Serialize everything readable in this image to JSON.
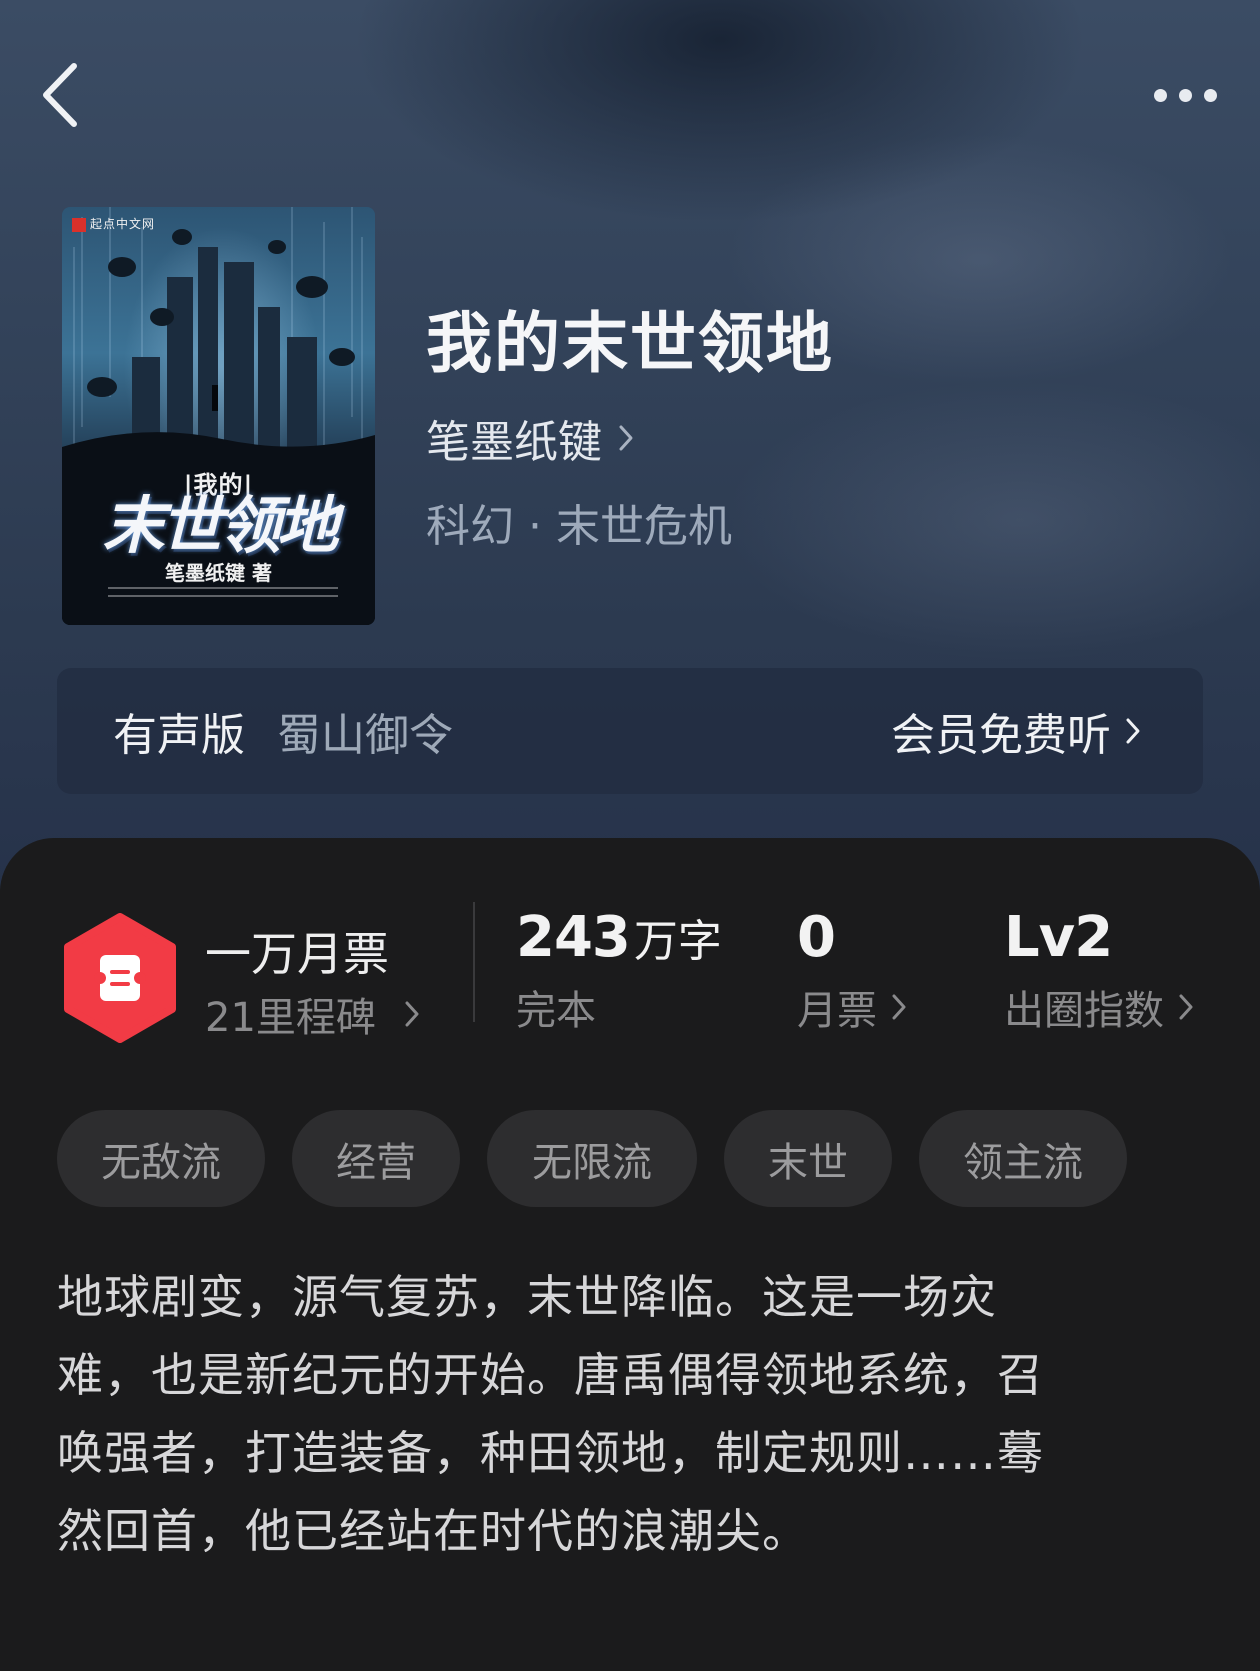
{
  "header": {
    "back_icon": "chevron-left-icon",
    "more_icon": "more-horizontal-icon"
  },
  "cover": {
    "publisher": "起点中文网",
    "title_top": "|我的|",
    "title_main": "末世领地",
    "author_line": "笔墨纸键 著"
  },
  "book": {
    "title": "我的末世领地",
    "author": "笔墨纸键",
    "genre": "科幻 · 末世危机"
  },
  "audio": {
    "label": "有声版",
    "narrator": "蜀山御令",
    "cta": "会员免费听"
  },
  "monthly_ticket": {
    "badge_icon": "ticket-badge-icon",
    "badge_color": "#f23b45",
    "title": "一万月票",
    "milestone": "21里程碑"
  },
  "stats": {
    "words_number": "243",
    "words_unit": "万字",
    "words_label": "完本",
    "votes_number": "0",
    "votes_label": "月票",
    "index_number": "Lv2",
    "index_label": "出圈指数"
  },
  "tags": [
    {
      "label": "无敌流"
    },
    {
      "label": "经营"
    },
    {
      "label": "无限流"
    },
    {
      "label": "末世"
    },
    {
      "label": "领主流"
    }
  ],
  "synopsis": [
    "地球剧变，源气复苏，末世降临。这是一场灾",
    "难，也是新纪元的开始。唐禹偶得领地系统，召",
    "唤强者，打造装备，种田领地，制定规则……蓦",
    "然回首，他已经站在时代的浪潮尖。"
  ]
}
